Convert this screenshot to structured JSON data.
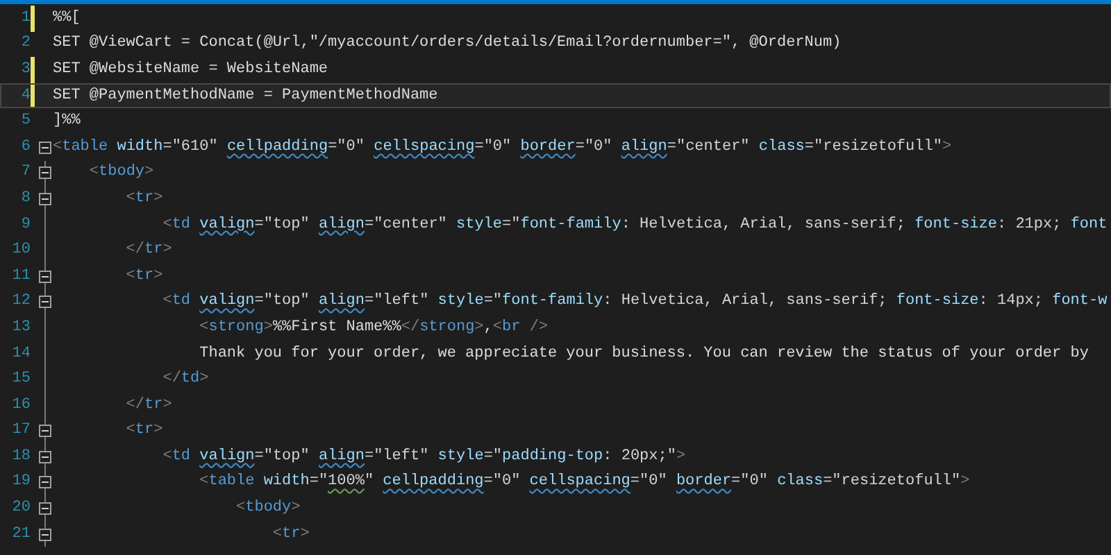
{
  "editor": {
    "lines": [
      {
        "number": "1",
        "changed": true,
        "fold": false,
        "current": false,
        "tokens": [
          {
            "text": "%%[",
            "kind": "text"
          }
        ]
      },
      {
        "number": "2",
        "changed": false,
        "fold": false,
        "current": false,
        "tokens": [
          {
            "text": "SET @ViewCart = Concat(@Url,\"/myaccount/orders/details/Email?ordernumber=\", @OrderNum)",
            "kind": "text"
          }
        ]
      },
      {
        "number": "3",
        "changed": true,
        "fold": false,
        "current": false,
        "tokens": [
          {
            "text": "SET @WebsiteName = WebsiteName",
            "kind": "text"
          }
        ]
      },
      {
        "number": "4",
        "changed": true,
        "fold": false,
        "current": true,
        "tokens": [
          {
            "text": "SET @PaymentMethodName = PaymentMethodName",
            "kind": "text"
          }
        ]
      },
      {
        "number": "5",
        "changed": false,
        "fold": false,
        "current": false,
        "tokens": [
          {
            "text": "]%%",
            "kind": "text"
          }
        ]
      },
      {
        "number": "6",
        "changed": false,
        "fold": true,
        "current": false,
        "tokens": [
          {
            "text": "<",
            "kind": "punct"
          },
          {
            "text": "table",
            "kind": "tag"
          },
          {
            "text": " width",
            "kind": "attr"
          },
          {
            "text": "=\"610\" ",
            "kind": "value"
          },
          {
            "text": "cellpadding",
            "kind": "attr",
            "squiggle": true
          },
          {
            "text": "=\"0\" ",
            "kind": "value"
          },
          {
            "text": "cellspacing",
            "kind": "attr",
            "squiggle": true
          },
          {
            "text": "=\"0\" ",
            "kind": "value"
          },
          {
            "text": "border",
            "kind": "attr",
            "squiggle": true
          },
          {
            "text": "=\"0\" ",
            "kind": "value"
          },
          {
            "text": "align",
            "kind": "attr",
            "squiggle": true
          },
          {
            "text": "=\"center\" ",
            "kind": "value"
          },
          {
            "text": "class",
            "kind": "attr"
          },
          {
            "text": "=\"resizetofull\"",
            "kind": "value"
          },
          {
            "text": ">",
            "kind": "punct"
          }
        ]
      },
      {
        "number": "7",
        "changed": false,
        "fold": true,
        "current": false,
        "tokens": [
          {
            "text": "    <",
            "kind": "punct"
          },
          {
            "text": "tbody",
            "kind": "tag"
          },
          {
            "text": ">",
            "kind": "punct"
          }
        ]
      },
      {
        "number": "8",
        "changed": false,
        "fold": true,
        "current": false,
        "tokens": [
          {
            "text": "        <",
            "kind": "punct"
          },
          {
            "text": "tr",
            "kind": "tag"
          },
          {
            "text": ">",
            "kind": "punct"
          }
        ]
      },
      {
        "number": "9",
        "changed": false,
        "fold": false,
        "current": false,
        "tokens": [
          {
            "text": "            <",
            "kind": "punct"
          },
          {
            "text": "td ",
            "kind": "tag"
          },
          {
            "text": "valign",
            "kind": "attr",
            "squiggle": true
          },
          {
            "text": "=\"top\" ",
            "kind": "value"
          },
          {
            "text": "align",
            "kind": "attr",
            "squiggle": true
          },
          {
            "text": "=\"center\" ",
            "kind": "value"
          },
          {
            "text": "style",
            "kind": "attr"
          },
          {
            "text": "=\"",
            "kind": "value"
          },
          {
            "text": "font-family",
            "kind": "attr"
          },
          {
            "text": ": Helvetica, Arial, sans-serif; ",
            "kind": "value"
          },
          {
            "text": "font-size",
            "kind": "attr"
          },
          {
            "text": ": 21px; ",
            "kind": "value"
          },
          {
            "text": "font",
            "kind": "attr"
          }
        ]
      },
      {
        "number": "10",
        "changed": false,
        "fold": false,
        "current": false,
        "tokens": [
          {
            "text": "        </",
            "kind": "punct"
          },
          {
            "text": "tr",
            "kind": "tag"
          },
          {
            "text": ">",
            "kind": "punct"
          }
        ]
      },
      {
        "number": "11",
        "changed": false,
        "fold": true,
        "current": false,
        "tokens": [
          {
            "text": "        <",
            "kind": "punct"
          },
          {
            "text": "tr",
            "kind": "tag"
          },
          {
            "text": ">",
            "kind": "punct"
          }
        ]
      },
      {
        "number": "12",
        "changed": false,
        "fold": true,
        "current": false,
        "tokens": [
          {
            "text": "            <",
            "kind": "punct"
          },
          {
            "text": "td ",
            "kind": "tag"
          },
          {
            "text": "valign",
            "kind": "attr",
            "squiggle": true
          },
          {
            "text": "=\"top\" ",
            "kind": "value"
          },
          {
            "text": "align",
            "kind": "attr",
            "squiggle": true
          },
          {
            "text": "=\"left\" ",
            "kind": "value"
          },
          {
            "text": "style",
            "kind": "attr"
          },
          {
            "text": "=\"",
            "kind": "value"
          },
          {
            "text": "font-family",
            "kind": "attr"
          },
          {
            "text": ": Helvetica, Arial, sans-serif; ",
            "kind": "value"
          },
          {
            "text": "font-size",
            "kind": "attr"
          },
          {
            "text": ": 14px; ",
            "kind": "value"
          },
          {
            "text": "font-w",
            "kind": "attr"
          }
        ]
      },
      {
        "number": "13",
        "changed": false,
        "fold": false,
        "current": false,
        "tokens": [
          {
            "text": "                <",
            "kind": "punct"
          },
          {
            "text": "strong",
            "kind": "tag"
          },
          {
            "text": ">",
            "kind": "punct"
          },
          {
            "text": "%%First Name%%",
            "kind": "text"
          },
          {
            "text": "</",
            "kind": "punct"
          },
          {
            "text": "strong",
            "kind": "tag"
          },
          {
            "text": ">",
            "kind": "punct"
          },
          {
            "text": ",",
            "kind": "text"
          },
          {
            "text": "<",
            "kind": "punct"
          },
          {
            "text": "br ",
            "kind": "tag"
          },
          {
            "text": "/>",
            "kind": "punct"
          }
        ]
      },
      {
        "number": "14",
        "changed": false,
        "fold": false,
        "current": false,
        "tokens": [
          {
            "text": "                Thank you for your order, we appreciate your business. You can review the status of your order by",
            "kind": "text"
          }
        ]
      },
      {
        "number": "15",
        "changed": false,
        "fold": false,
        "current": false,
        "tokens": [
          {
            "text": "            </",
            "kind": "punct"
          },
          {
            "text": "td",
            "kind": "tag"
          },
          {
            "text": ">",
            "kind": "punct"
          }
        ]
      },
      {
        "number": "16",
        "changed": false,
        "fold": false,
        "current": false,
        "tokens": [
          {
            "text": "        </",
            "kind": "punct"
          },
          {
            "text": "tr",
            "kind": "tag"
          },
          {
            "text": ">",
            "kind": "punct"
          }
        ]
      },
      {
        "number": "17",
        "changed": false,
        "fold": true,
        "current": false,
        "tokens": [
          {
            "text": "        <",
            "kind": "punct"
          },
          {
            "text": "tr",
            "kind": "tag"
          },
          {
            "text": ">",
            "kind": "punct"
          }
        ]
      },
      {
        "number": "18",
        "changed": false,
        "fold": true,
        "current": false,
        "tokens": [
          {
            "text": "            <",
            "kind": "punct"
          },
          {
            "text": "td ",
            "kind": "tag"
          },
          {
            "text": "valign",
            "kind": "attr",
            "squiggle": true
          },
          {
            "text": "=\"top\" ",
            "kind": "value"
          },
          {
            "text": "align",
            "kind": "attr",
            "squiggle": true
          },
          {
            "text": "=\"left\" ",
            "kind": "value"
          },
          {
            "text": "style",
            "kind": "attr"
          },
          {
            "text": "=\"",
            "kind": "value"
          },
          {
            "text": "padding-top",
            "kind": "attr"
          },
          {
            "text": ": 20px;\"",
            "kind": "value"
          },
          {
            "text": ">",
            "kind": "punct"
          }
        ]
      },
      {
        "number": "19",
        "changed": false,
        "fold": true,
        "current": false,
        "tokens": [
          {
            "text": "                <",
            "kind": "punct"
          },
          {
            "text": "table",
            "kind": "tag"
          },
          {
            "text": " width",
            "kind": "attr"
          },
          {
            "text": "=\"",
            "kind": "value"
          },
          {
            "text": "100%",
            "kind": "value",
            "warning": true
          },
          {
            "text": "\" ",
            "kind": "value"
          },
          {
            "text": "cellpadding",
            "kind": "attr",
            "squiggle": true
          },
          {
            "text": "=\"0\" ",
            "kind": "value"
          },
          {
            "text": "cellspacing",
            "kind": "attr",
            "squiggle": true
          },
          {
            "text": "=\"0\" ",
            "kind": "value"
          },
          {
            "text": "border",
            "kind": "attr",
            "squiggle": true
          },
          {
            "text": "=\"0\" ",
            "kind": "value"
          },
          {
            "text": "class",
            "kind": "attr"
          },
          {
            "text": "=\"resizetofull\"",
            "kind": "value"
          },
          {
            "text": ">",
            "kind": "punct"
          }
        ]
      },
      {
        "number": "20",
        "changed": false,
        "fold": true,
        "current": false,
        "tokens": [
          {
            "text": "                    <",
            "kind": "punct"
          },
          {
            "text": "tbody",
            "kind": "tag"
          },
          {
            "text": ">",
            "kind": "punct"
          }
        ]
      },
      {
        "number": "21",
        "changed": false,
        "fold": true,
        "current": false,
        "tokens": [
          {
            "text": "                        <",
            "kind": "punct"
          },
          {
            "text": "tr",
            "kind": "tag"
          },
          {
            "text": ">",
            "kind": "punct"
          }
        ]
      }
    ]
  }
}
